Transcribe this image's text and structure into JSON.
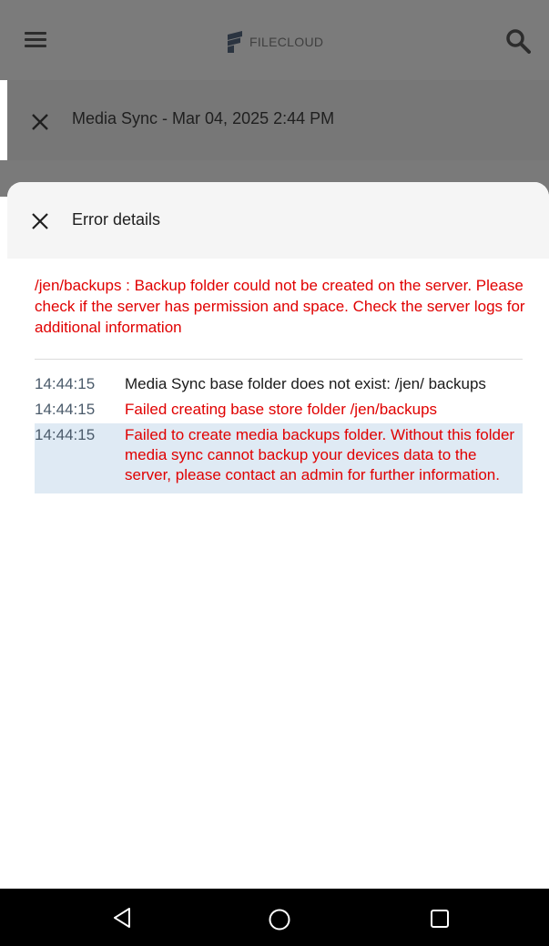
{
  "app": {
    "brand_name": "FILECLOUD",
    "brand_color": "#3f3f3f",
    "icons": {
      "menu": "menu-icon",
      "search": "search-icon",
      "logo": "filecloud-logo-icon"
    }
  },
  "sync_bar": {
    "title": "Media Sync - Mar 04, 2025 2:44 PM",
    "close_icon": "close-icon"
  },
  "error_sheet": {
    "title": "Error details",
    "close_icon": "close-icon",
    "summary": "/jen/backups : Backup folder could not be created on the server. Please check if the server has permission and space. Check the server logs for additional information",
    "error_color": "#e00000",
    "highlight_color": "#dfeaf4",
    "log": [
      {
        "time": "14:44:15",
        "message": "Media Sync base folder does not exist: /jen/ backups",
        "level": "info"
      },
      {
        "time": "14:44:15",
        "message": "Failed creating base store folder /jen/backups",
        "level": "error"
      },
      {
        "time": "14:44:15",
        "message": "Failed to create media backups folder. Without this folder media sync cannot backup your devices data to the server, please contact an admin for further information.",
        "level": "error",
        "selected": true
      }
    ]
  },
  "nav_bar": {
    "back_icon": "back-triangle-icon",
    "home_icon": "home-circle-icon",
    "recents_icon": "recents-square-icon"
  }
}
